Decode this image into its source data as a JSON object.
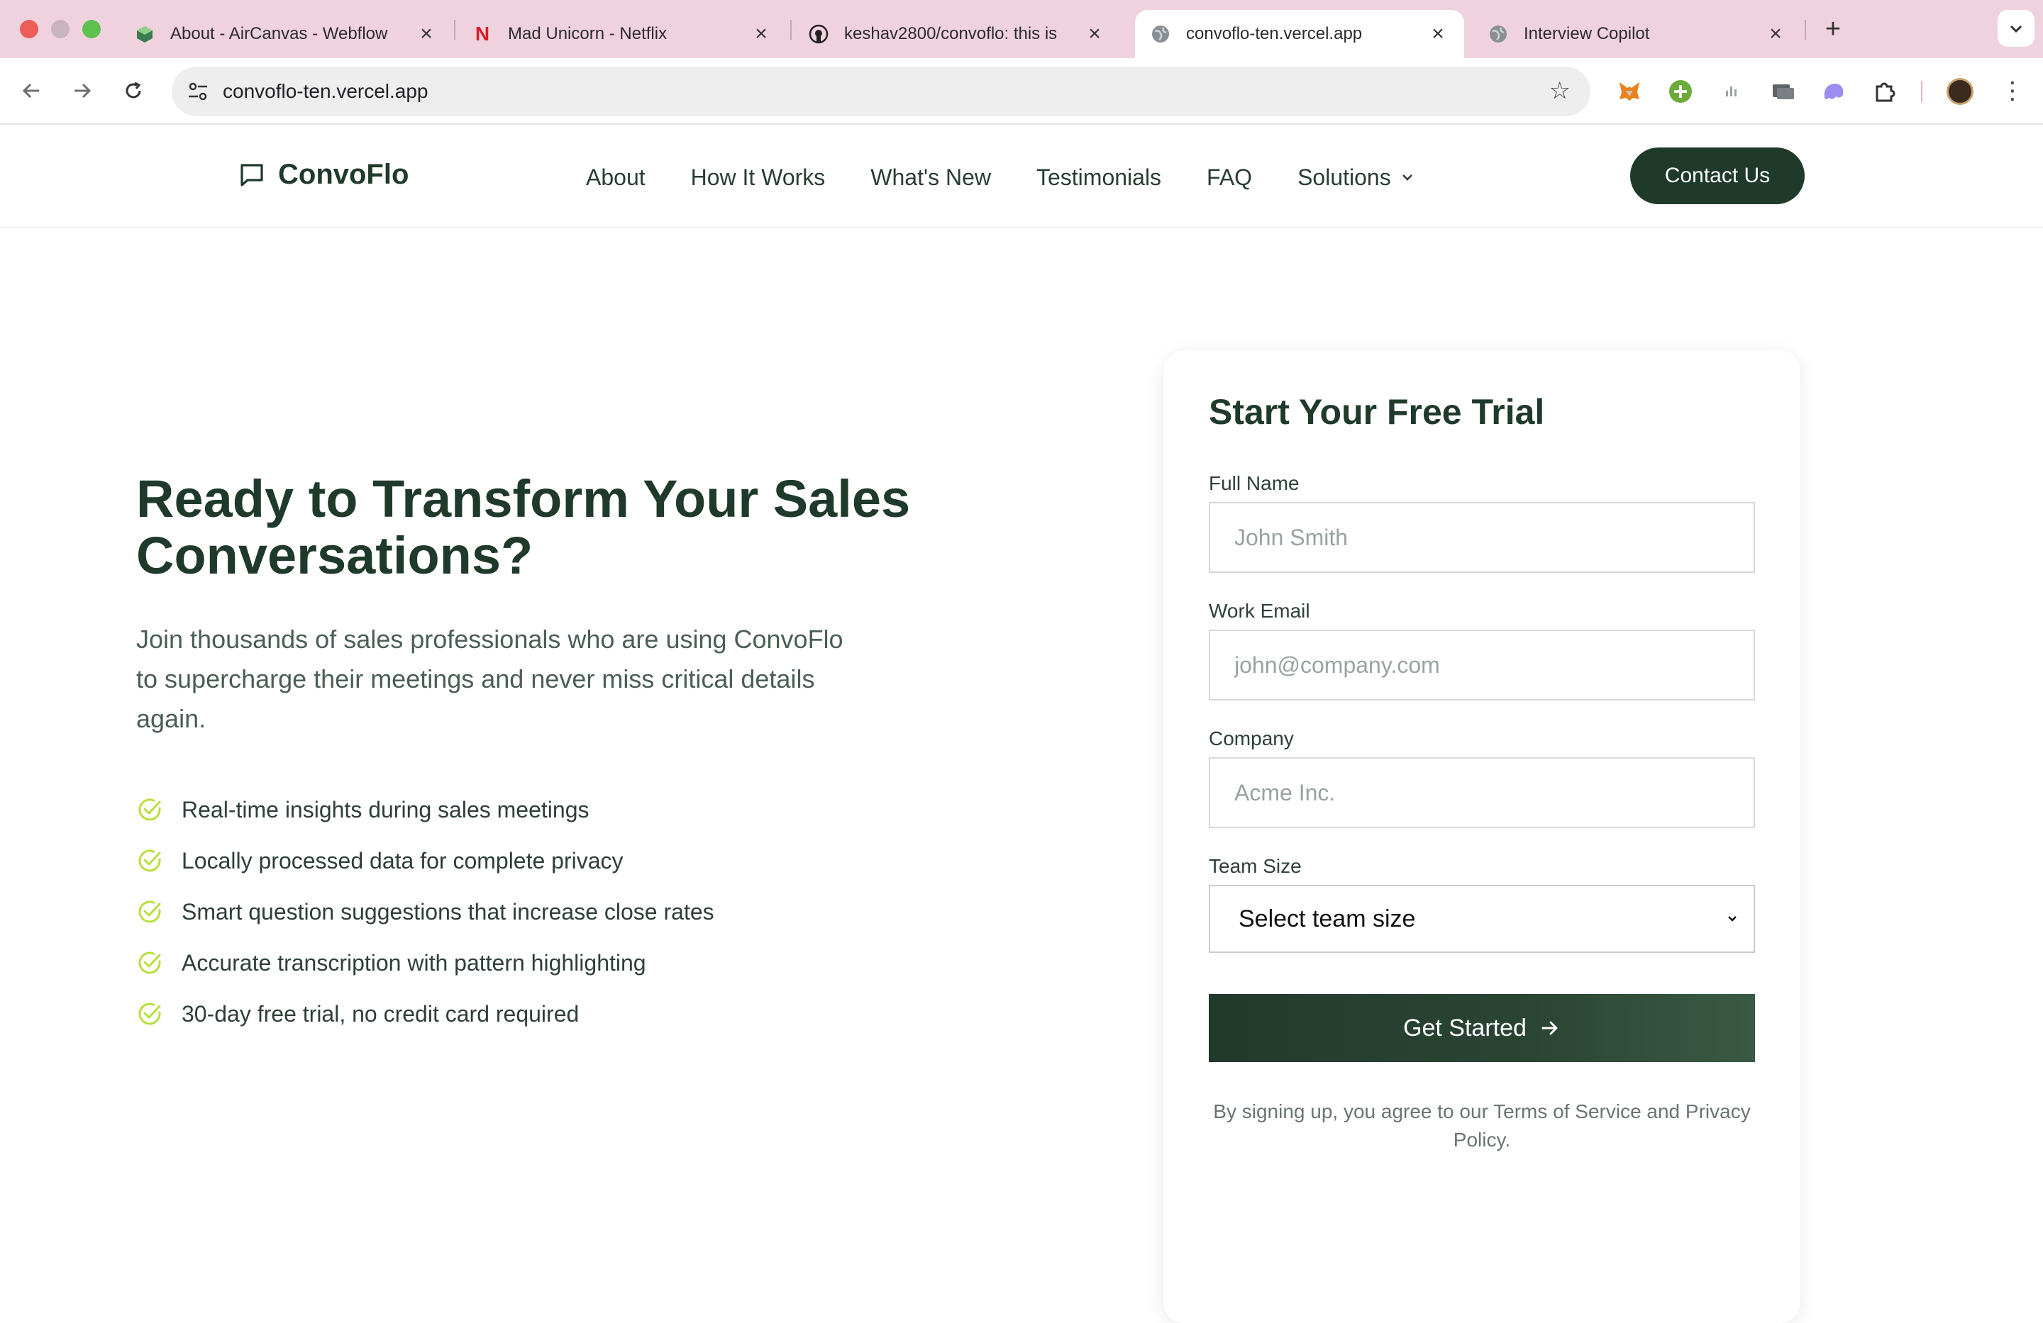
{
  "browser": {
    "tabs": [
      {
        "title": "About - AirCanvas - Webflow",
        "icon": "webflow-icon"
      },
      {
        "title": "Mad Unicorn - Netflix",
        "icon": "netflix-icon"
      },
      {
        "title": "keshav2800/convoflo: this is",
        "icon": "github-icon"
      },
      {
        "title": "convoflo-ten.vercel.app",
        "icon": "globe-icon",
        "active": true
      },
      {
        "title": "Interview Copilot",
        "icon": "globe-icon"
      }
    ],
    "url": "convoflo-ten.vercel.app",
    "new_tab": "+",
    "accent": "#f0d2de"
  },
  "site": {
    "brand": "ConvoFlo",
    "nav": [
      "About",
      "How It Works",
      "What's New",
      "Testimonials",
      "FAQ",
      "Solutions"
    ],
    "contact_label": "Contact Us",
    "primary_color": "#1f3a2b",
    "check_color": "#b6e03f"
  },
  "hero": {
    "title": "Ready to Transform Your Sales Conversations?",
    "subtitle": "Join thousands of sales professionals who are using ConvoFlo to supercharge their meetings and never miss critical details again.",
    "features": [
      "Real-time insights during sales meetings",
      "Locally processed data for complete privacy",
      "Smart question suggestions that increase close rates",
      "Accurate transcription with pattern highlighting",
      "30-day free trial, no credit card required"
    ]
  },
  "form": {
    "title": "Start Your Free Trial",
    "full_name_label": "Full Name",
    "full_name_placeholder": "John Smith",
    "email_label": "Work Email",
    "email_placeholder": "john@company.com",
    "company_label": "Company",
    "company_placeholder": "Acme Inc.",
    "team_size_label": "Team Size",
    "team_size_value": "Select team size",
    "submit_label": "Get Started",
    "legal": "By signing up, you agree to our Terms of Service and Privacy Policy."
  }
}
